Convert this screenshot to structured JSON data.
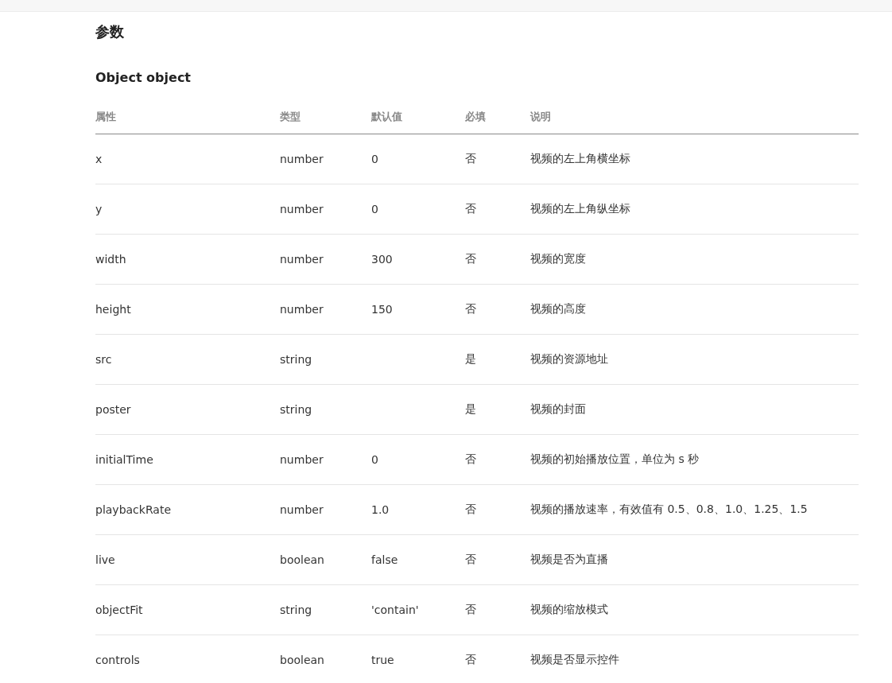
{
  "section_title": "参数",
  "table_title": "Object object",
  "table": {
    "columns": [
      "属性",
      "类型",
      "默认值",
      "必填",
      "说明"
    ],
    "rows": [
      {
        "name": "x",
        "type": "number",
        "default": "0",
        "required": "否",
        "description": "视频的左上角横坐标"
      },
      {
        "name": "y",
        "type": "number",
        "default": "0",
        "required": "否",
        "description": "视频的左上角纵坐标"
      },
      {
        "name": "width",
        "type": "number",
        "default": "300",
        "required": "否",
        "description": "视频的宽度"
      },
      {
        "name": "height",
        "type": "number",
        "default": "150",
        "required": "否",
        "description": "视频的高度"
      },
      {
        "name": "src",
        "type": "string",
        "required": "是",
        "description": "视频的资源地址"
      },
      {
        "name": "poster",
        "type": "string",
        "required": "是",
        "description": "视频的封面"
      },
      {
        "name": "initialTime",
        "type": "number",
        "default": "0",
        "required": "否",
        "description": "视频的初始播放位置，单位为 s 秒"
      },
      {
        "name": "playbackRate",
        "type": "number",
        "default": "1.0",
        "required": "否",
        "description": "视频的播放速率，有效值有 0.5、0.8、1.0、1.25、1.5"
      },
      {
        "name": "live",
        "type": "boolean",
        "default": "false",
        "required": "否",
        "description": "视频是否为直播"
      },
      {
        "name": "objectFit",
        "type": "string",
        "default": "'contain'",
        "required": "否",
        "description": "视频的缩放模式"
      },
      {
        "name": "controls",
        "type": "boolean",
        "default": "true",
        "required": "否",
        "description": "视频是否显示控件"
      }
    ]
  }
}
